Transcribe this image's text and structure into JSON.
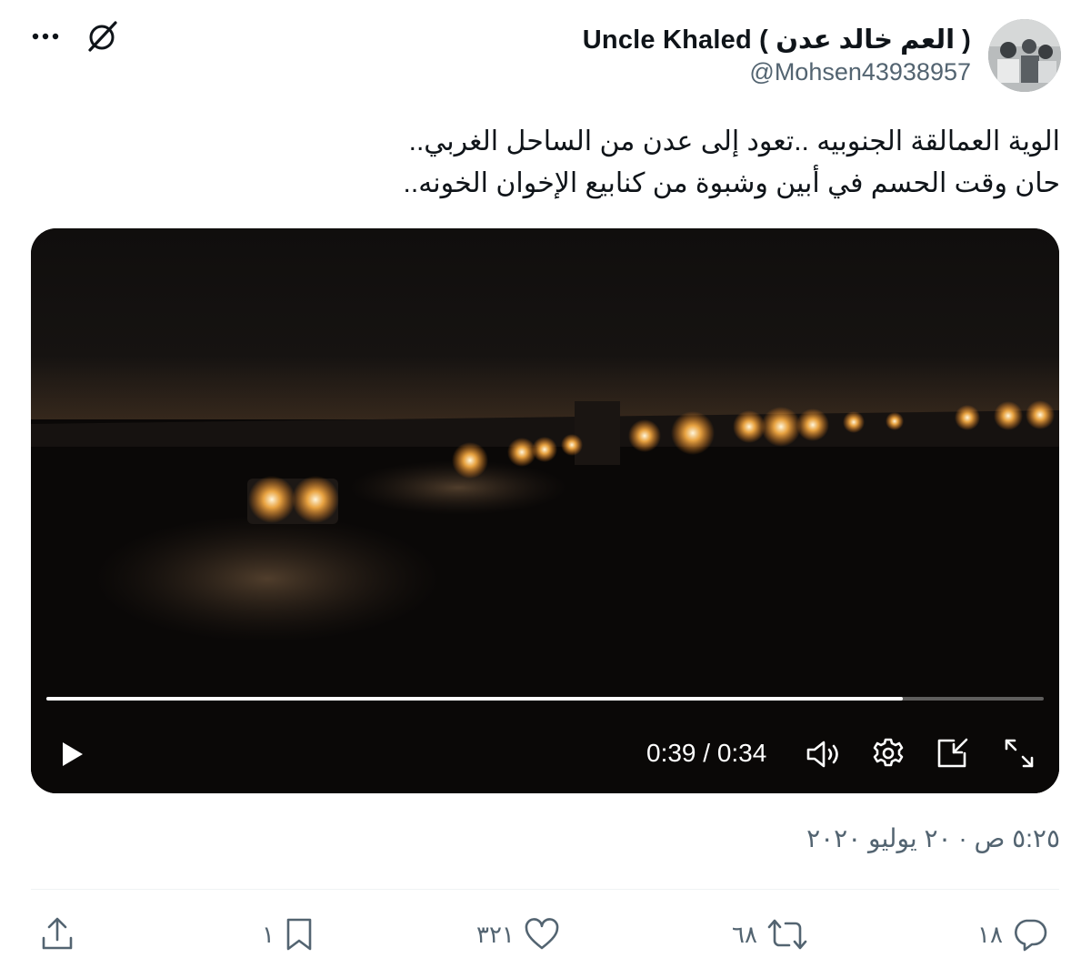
{
  "author": {
    "display_name": "Uncle Khaled ( العم خالد عدن )",
    "handle": "@Mohsen43938957"
  },
  "tweet": {
    "lines": [
      "الوية العمالقة الجنوبيه ..تعود إلى عدن من الساحل الغربي..",
      "حان وقت الحسم في أبين وشبوة من كنابيع الإخوان الخونه.."
    ],
    "timestamp": "٥:٢٥ ص · ٢٠ يوليو ٢٠٢٠"
  },
  "video": {
    "time_display": "0:39 / 0:34",
    "progress_fraction": 0.859,
    "controls": [
      "play-icon",
      "volume-icon",
      "settings-icon",
      "pip-icon",
      "fullscreen-icon"
    ]
  },
  "actions": {
    "reply_count": "١٨",
    "retweet_count": "٦٨",
    "like_count": "٣٢١",
    "bookmark_count": "١"
  },
  "colors": {
    "text": "#0f1419",
    "secondary": "#536471",
    "divider": "#eff3f4",
    "video_bg": "#0b0908"
  }
}
